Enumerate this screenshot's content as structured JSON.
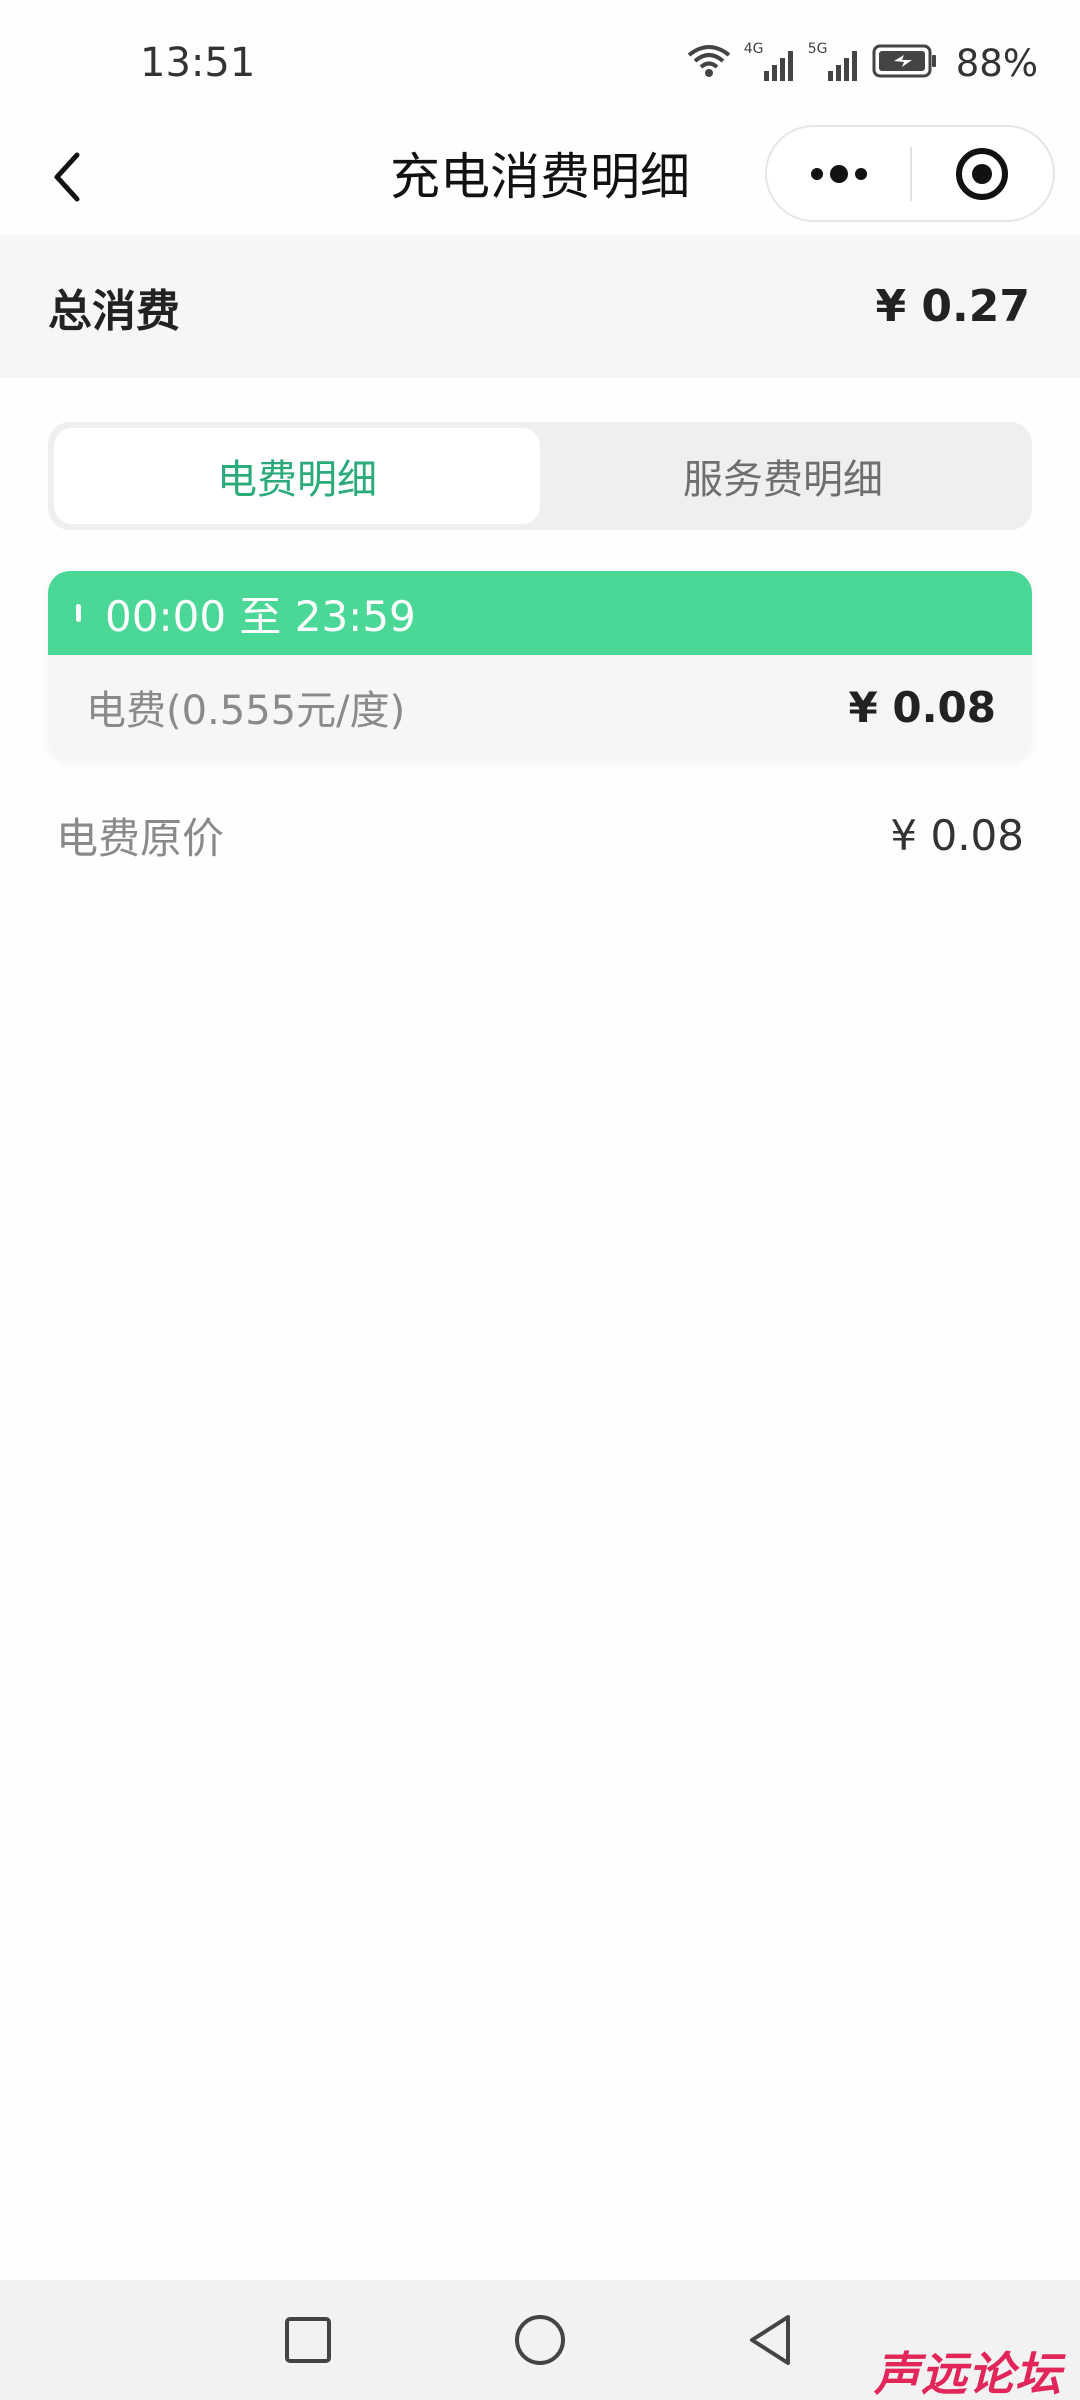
{
  "status_bar": {
    "time": "13:51",
    "network_4g": "4G",
    "network_5g": "5G",
    "battery_pct": "88%"
  },
  "nav": {
    "title": "充电消费明细",
    "back_icon": "chevron-left-icon",
    "more_icon": "more-dots-icon",
    "close_icon": "target-circle-icon"
  },
  "total": {
    "label": "总消费",
    "value": "¥ 0.27"
  },
  "tabs": [
    {
      "label": "电费明细",
      "active": true
    },
    {
      "label": "服务费明细",
      "active": false
    }
  ],
  "period_card": {
    "time_range": "00:00 至 23:59",
    "fee_label": "电费(0.555元/度)",
    "fee_value": "¥ 0.08"
  },
  "original_price": {
    "label": "电费原价",
    "value": "¥ 0.08"
  },
  "watermark": "声远论坛",
  "colors": {
    "accent_green": "#2aab79",
    "header_green": "#4bd795",
    "watermark_pink": "#e22659"
  }
}
